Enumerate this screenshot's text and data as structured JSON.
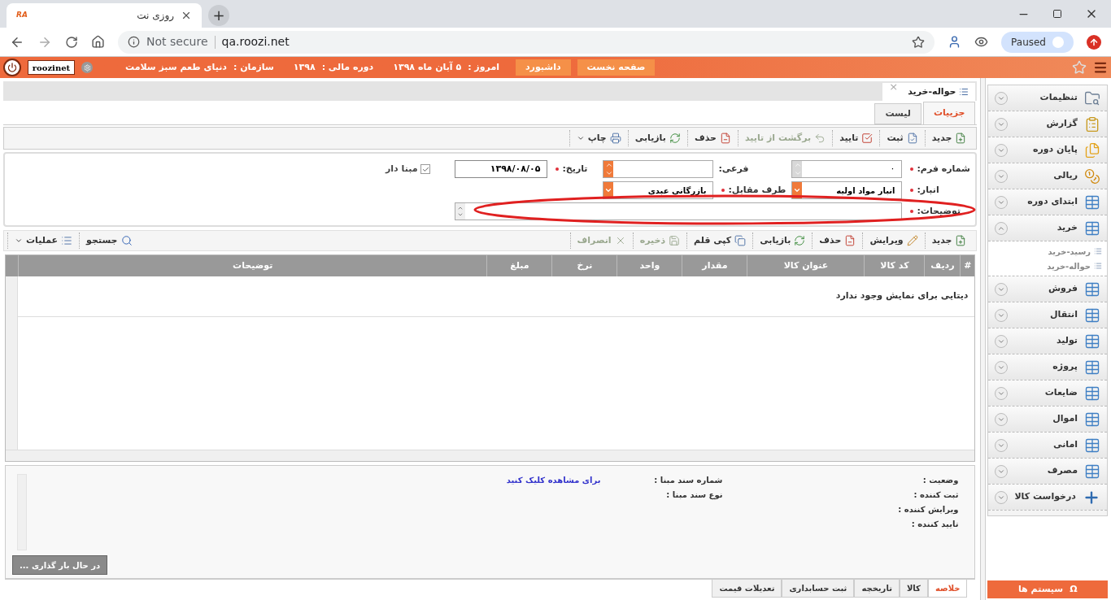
{
  "browser": {
    "tab": {
      "favicon": "RA",
      "title": "روزی نت"
    },
    "new_tab": "+",
    "address": {
      "security": "Not secure",
      "url": "qa.roozi.net"
    },
    "profile": "Paused"
  },
  "header": {
    "user": "roozinet",
    "buttons": [
      "صفحه نخست",
      "داشبورد"
    ],
    "info": [
      {
        "label": "امروز :",
        "value": "۵ آبان ماه ۱۳۹۸"
      },
      {
        "label": "دوره مالی :",
        "value": "۱۳۹۸"
      },
      {
        "label": "سازمان :",
        "value": "دنیای طعم سبز سلامت"
      }
    ]
  },
  "document_tab": {
    "title": "حواله-خرید",
    "close": "×"
  },
  "view_tabs": [
    {
      "label": "جزییات",
      "selected": true
    },
    {
      "label": "لیست",
      "selected": false
    }
  ],
  "toolbar": [
    {
      "label": "جدید",
      "kind": "new",
      "disabled": false
    },
    {
      "label": "ثبت",
      "kind": "register",
      "disabled": false
    },
    {
      "label": "تایید",
      "kind": "approve",
      "disabled": false
    },
    {
      "label": "برگشت از تایید",
      "kind": "unapprove",
      "disabled": true
    },
    {
      "label": "حذف",
      "kind": "delete",
      "disabled": false
    },
    {
      "label": "بازیابی",
      "kind": "refresh",
      "disabled": false
    },
    {
      "label": "چاپ",
      "kind": "print",
      "disabled": false
    }
  ],
  "form": {
    "rows": [
      {
        "fields": [
          {
            "label": "شماره فرم:",
            "required": true,
            "kind": "spinner",
            "value": "۰",
            "disabled": true
          },
          {
            "label": "فرعی:",
            "required": false,
            "kind": "spinner",
            "disabled": false
          },
          {
            "label": "تاریخ:",
            "required": true,
            "kind": "text",
            "value": "۱۳۹۸/۰۸/۰۵"
          },
          {
            "label": "مبنا دار",
            "kind": "checkbox",
            "checked": true
          }
        ]
      },
      {
        "fields": [
          {
            "label": "انبار:",
            "required": true,
            "kind": "select",
            "value": "انبار مواد اولیه"
          },
          {
            "label": "طرف مقابل:",
            "required": true,
            "kind": "select",
            "value": "بازرگانی عبدی"
          }
        ]
      },
      {
        "fields": [
          {
            "label": "توضیحات:",
            "required": true,
            "kind": "textarea"
          }
        ]
      }
    ],
    "annotation": {
      "kind": "ellipse"
    }
  },
  "grid_toolbar": {
    "actions": [
      {
        "label": "جدید",
        "kind": "new",
        "disabled": false
      },
      {
        "label": "ویرایش",
        "kind": "edit",
        "disabled": false
      },
      {
        "label": "حذف",
        "kind": "delete",
        "disabled": false
      },
      {
        "label": "بازیابی",
        "kind": "refresh",
        "disabled": false
      },
      {
        "label": "کپی قلم",
        "kind": "copy",
        "disabled": false
      },
      {
        "label": "ذخیره",
        "kind": "save",
        "disabled": true
      },
      {
        "label": "انصراف",
        "kind": "cancel",
        "disabled": true
      }
    ],
    "tools": [
      {
        "label": "جستجو",
        "kind": "search"
      },
      {
        "label": "عملیات",
        "kind": "menu"
      }
    ]
  },
  "table": {
    "columns": [
      "#",
      "ردیف",
      "کد کالا",
      "عنوان کالا",
      "مقدار",
      "واحد",
      "نرخ",
      "مبلغ",
      "توضیحات"
    ],
    "empty_message": "دیتایی برای نمایش وجود ندارد"
  },
  "summary": {
    "status_fields": [
      "وضعیت :",
      "ثبت کننده :",
      "ویرایش کننده :",
      "تایید کننده :"
    ],
    "source_fields": [
      {
        "label": "شماره سند مبنا :",
        "link": "برای مشاهده کلیک کنید"
      },
      {
        "label": "نوع سند مبنا :"
      }
    ],
    "loading": "در حال بار گذاری ..."
  },
  "bottom_tabs": [
    {
      "label": "خلاصه",
      "selected": true
    },
    {
      "label": "کالا",
      "selected": false
    },
    {
      "label": "تاریخچه",
      "selected": false
    },
    {
      "label": "ثبت حسابداری",
      "selected": false
    },
    {
      "label": "تعدیلات قیمت",
      "selected": false
    }
  ],
  "sidebar": {
    "items": [
      {
        "label": "تنظیمات",
        "kind": "settings",
        "expanded": false
      },
      {
        "label": "گزارش",
        "kind": "report",
        "expanded": false
      },
      {
        "label": "پایان دوره",
        "kind": "closing",
        "expanded": false
      },
      {
        "label": "ریالی",
        "kind": "currency",
        "expanded": false
      },
      {
        "label": "ابتدای دوره",
        "kind": "module",
        "expanded": false
      },
      {
        "label": "خرید",
        "kind": "module",
        "expanded": true,
        "children": [
          {
            "label": "رسید-خرید"
          },
          {
            "label": "حواله-خرید"
          }
        ]
      },
      {
        "label": "فروش",
        "kind": "module",
        "expanded": false
      },
      {
        "label": "انتقال",
        "kind": "module",
        "expanded": false
      },
      {
        "label": "تولید",
        "kind": "module",
        "expanded": false
      },
      {
        "label": "پروژه",
        "kind": "module",
        "expanded": false
      },
      {
        "label": "ضایعات",
        "kind": "module",
        "expanded": false
      },
      {
        "label": "اموال",
        "kind": "module",
        "expanded": false
      },
      {
        "label": "امانی",
        "kind": "module",
        "expanded": false
      },
      {
        "label": "مصرف",
        "kind": "module",
        "expanded": false
      },
      {
        "label": "درخواست کالا",
        "kind": "request",
        "expanded": false
      }
    ],
    "footer": {
      "symbol": "Ω",
      "label": "سیستم ها"
    }
  }
}
